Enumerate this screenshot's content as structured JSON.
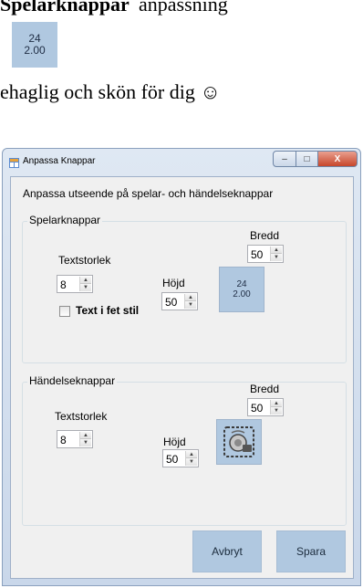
{
  "document": {
    "line1_bold": "Spelarknappar",
    "line1_rest": "anpassning",
    "tile_top": "24",
    "tile_bottom": "2.00",
    "line2": "ehaglig och skön för dig ☺"
  },
  "window": {
    "title": "Anpassa Knappar",
    "controls": {
      "minimize": "–",
      "maximize": "□",
      "close": "X"
    }
  },
  "subtitle": "Anpassa utseende på spelar- och händelseknappar",
  "player_group": {
    "title": "Spelarknappar",
    "text_size_label": "Textstorlek",
    "text_size_value": "8",
    "height_label": "Höjd",
    "height_value": "50",
    "width_label": "Bredd",
    "width_value": "50",
    "bold_label": "Text i fet stil",
    "bold_checked": false,
    "preview_top": "24",
    "preview_bottom": "2.00"
  },
  "event_group": {
    "title": "Händelseknappar",
    "text_size_label": "Textstorlek",
    "text_size_value": "8",
    "height_label": "Höjd",
    "height_value": "50",
    "width_label": "Bredd",
    "width_value": "50",
    "preview_icon": "whistle-icon"
  },
  "buttons": {
    "cancel": "Avbryt",
    "save": "Spara"
  },
  "colors": {
    "button_fill": "#b0c8e0",
    "client_bg": "#f0f0f0",
    "close_red": "#c7452a"
  }
}
